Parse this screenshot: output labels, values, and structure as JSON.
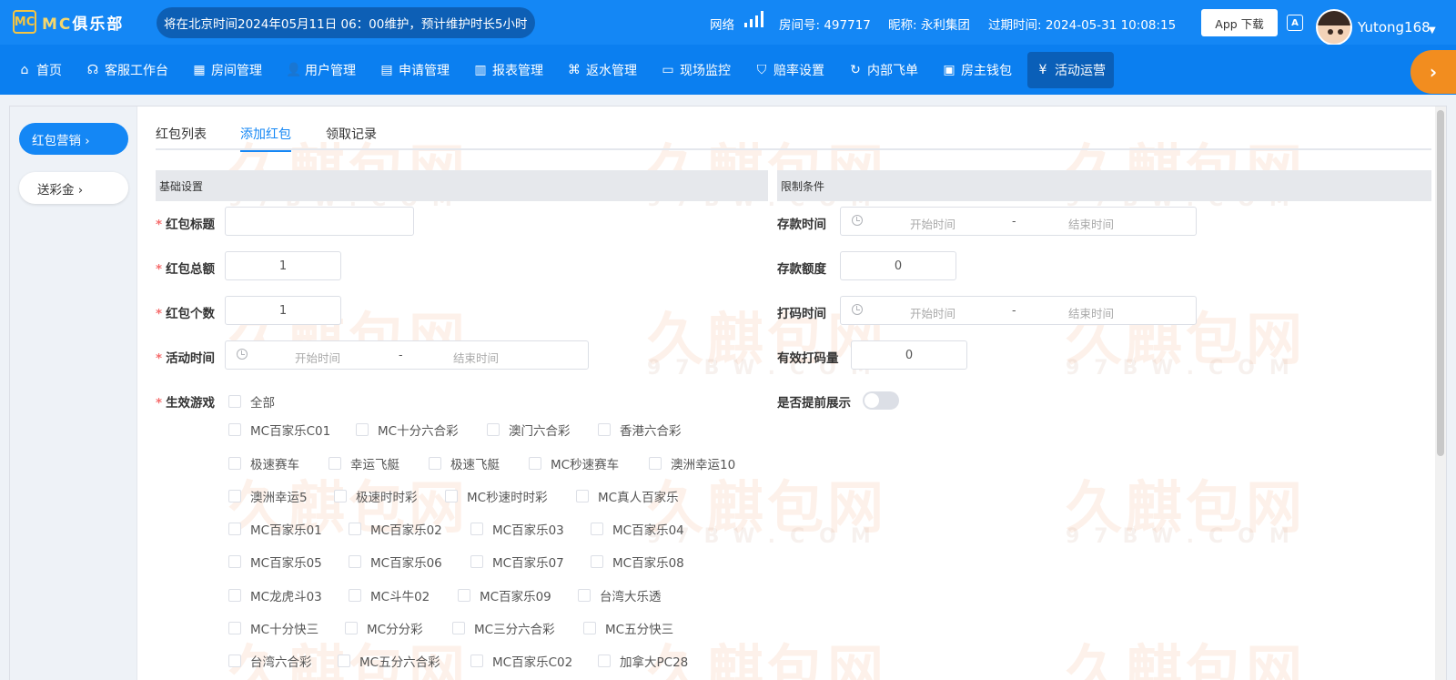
{
  "header": {
    "logo_mark": "MC",
    "logo_text_mc": "MC",
    "logo_text_rest": "俱乐部",
    "notice": "将在北京时间2024年05月11日 06：00维护，预计维护时长5小时",
    "network_label": "网络",
    "room_no": "房间号: 497717",
    "nickname": "昵称: 永利集团",
    "expire": "过期时间: 2024-05-31 10:08:15",
    "app_download": "App 下载",
    "translate_glyph": "A",
    "username": "Yutong168"
  },
  "nav": {
    "items": [
      {
        "label": "首页",
        "icon": "home-icon",
        "glyph": "⌂"
      },
      {
        "label": "客服工作台",
        "icon": "headset-icon",
        "glyph": "☊"
      },
      {
        "label": "房间管理",
        "icon": "grid-icon",
        "glyph": "▦"
      },
      {
        "label": "用户管理",
        "icon": "user-icon",
        "glyph": "👤"
      },
      {
        "label": "申请管理",
        "icon": "document-icon",
        "glyph": "▤"
      },
      {
        "label": "报表管理",
        "icon": "bar-chart-icon",
        "glyph": "▥"
      },
      {
        "label": "返水管理",
        "icon": "tag-icon",
        "glyph": "⌘"
      },
      {
        "label": "现场监控",
        "icon": "monitor-icon",
        "glyph": "▭"
      },
      {
        "label": "赔率设置",
        "icon": "shield-icon",
        "glyph": "⛉"
      },
      {
        "label": "内部飞单",
        "icon": "refresh-icon",
        "glyph": "↻"
      },
      {
        "label": "房主钱包",
        "icon": "wallet-icon",
        "glyph": "▣"
      },
      {
        "label": "活动运营",
        "icon": "yen-icon",
        "glyph": "¥"
      }
    ],
    "next_glyph": "›"
  },
  "sidebar": {
    "items": [
      {
        "label": "红包营销 ›"
      },
      {
        "label": "送彩金 ›"
      }
    ]
  },
  "tabs": {
    "items": [
      {
        "label": "红包列表"
      },
      {
        "label": "添加红包"
      },
      {
        "label": "领取记录"
      }
    ]
  },
  "basic": {
    "section_title": "基础设置",
    "title_label": "红包标题",
    "title_value": "",
    "amount_label": "红包总额",
    "amount_value": "1",
    "count_label": "红包个数",
    "count_value": "1",
    "time_label": "活动时间",
    "start_placeholder": "开始时间",
    "range_sep": "-",
    "end_placeholder": "结束时间",
    "games_label": "生效游戏",
    "all_label": "全部",
    "games": [
      "MC百家乐C01",
      "MC十分六合彩",
      "澳门六合彩",
      "香港六合彩",
      "极速赛车",
      "幸运飞艇",
      "极速飞艇",
      "MC秒速赛车",
      "澳洲幸运10",
      "澳洲幸运5",
      "极速时时彩",
      "MC秒速时时彩",
      "MC真人百家乐",
      "MC百家乐01",
      "MC百家乐02",
      "MC百家乐03",
      "MC百家乐04",
      "MC百家乐05",
      "MC百家乐06",
      "MC百家乐07",
      "MC百家乐08",
      "MC龙虎斗03",
      "MC斗牛02",
      "MC百家乐09",
      "台湾大乐透",
      "MC十分快三",
      "MC分分彩",
      "MC三分六合彩",
      "MC五分快三",
      "台湾六合彩",
      "MC五分六合彩",
      "MC百家乐C02",
      "加拿大PC28"
    ]
  },
  "limits": {
    "section_title": "限制条件",
    "deposit_time_label": "存款时间",
    "deposit_amount_label": "存款额度",
    "deposit_amount_value": "0",
    "bet_time_label": "打码时间",
    "valid_bet_label": "有效打码量",
    "valid_bet_value": "0",
    "preview_label": "是否提前展示",
    "preview_on": false
  },
  "watermark": {
    "text": "久麒包网",
    "sub": "97BW.COM"
  },
  "colors": {
    "primary": "#1487f5",
    "nav_bg": "#0b7ff0",
    "accent_orange": "#f28d1f",
    "required": "#f56c6c"
  }
}
